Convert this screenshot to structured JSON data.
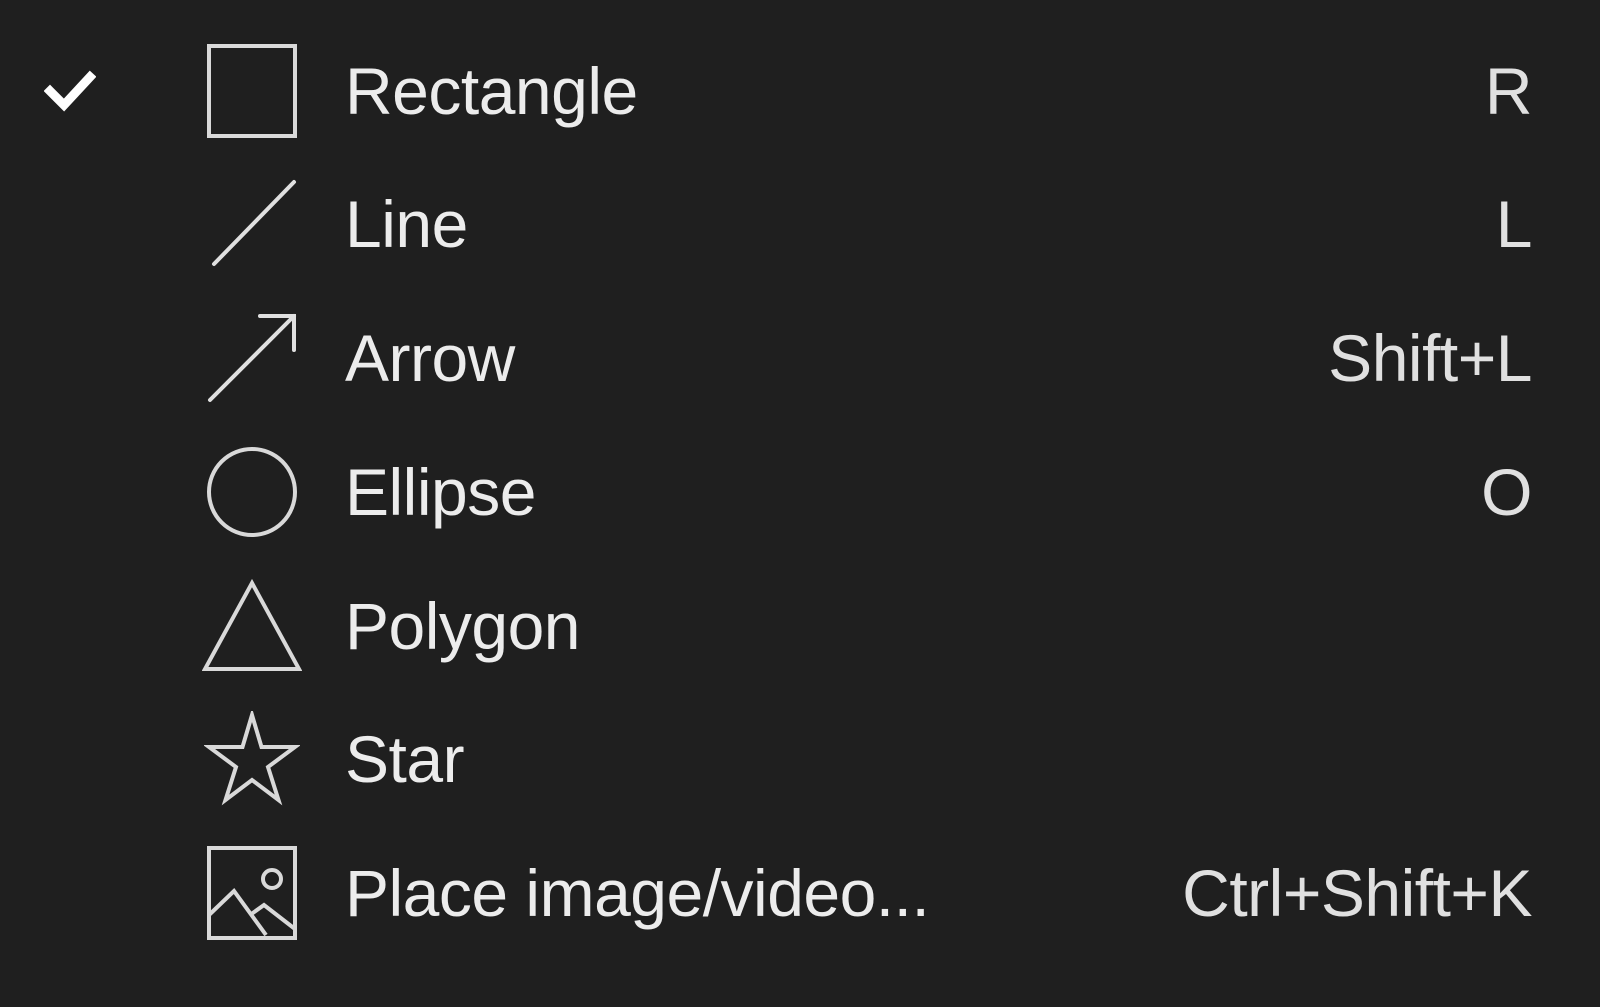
{
  "menu": {
    "items": [
      {
        "label": "Rectangle",
        "shortcut": "R",
        "icon": "rectangle-icon",
        "checked": true
      },
      {
        "label": "Line",
        "shortcut": "L",
        "icon": "line-icon",
        "checked": false
      },
      {
        "label": "Arrow",
        "shortcut": "Shift+L",
        "icon": "arrow-icon",
        "checked": false
      },
      {
        "label": "Ellipse",
        "shortcut": "O",
        "icon": "ellipse-icon",
        "checked": false
      },
      {
        "label": "Polygon",
        "shortcut": "",
        "icon": "polygon-icon",
        "checked": false
      },
      {
        "label": "Star",
        "shortcut": "",
        "icon": "star-icon",
        "checked": false
      },
      {
        "label": "Place image/video...",
        "shortcut": "Ctrl+Shift+K",
        "icon": "image-icon",
        "checked": false
      }
    ]
  },
  "colors": {
    "background": "#1f1f1f",
    "text": "#ececec",
    "icon_stroke": "#d9d9d9"
  }
}
